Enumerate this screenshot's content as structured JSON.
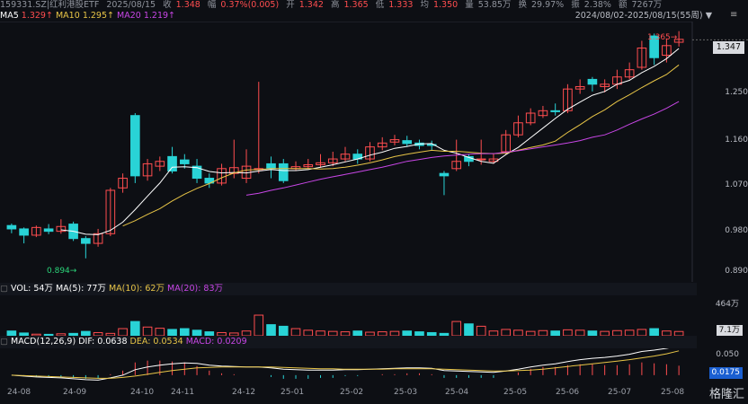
{
  "header": {
    "symbol": "159331.SZ|红利港股ETF",
    "date": "2025/08/15",
    "close_label": "收",
    "close": "1.348",
    "change_label": "幅",
    "change": "0.37%(0.005)",
    "open_label": "开",
    "open": "1.342",
    "high_label": "高",
    "high": "1.365",
    "low_label": "低",
    "low": "1.333",
    "avg_label": "均",
    "avg": "1.350",
    "volume_label": "量",
    "volume": "53.85万",
    "turnover_label": "换",
    "turnover": "29.97%",
    "amplitude_label": "振",
    "amplitude": "2.38%",
    "amount_label": "额",
    "amount": "7267万",
    "range": "2024/08/02-2025/08/15(55周)"
  },
  "ma_legend": {
    "ma5_label": "MA5",
    "ma5": "1.329↑",
    "ma10_label": "MA10",
    "ma10": "1.295↑",
    "ma20_label": "MA20",
    "ma20": "1.219↑"
  },
  "price_axis": {
    "ticks": [
      "1.250",
      "1.160",
      "1.070",
      "0.980",
      "0.890"
    ],
    "current": "1.347"
  },
  "annotations": {
    "max": "1.365",
    "min": "0.894"
  },
  "volume_panel": {
    "label": "VOL: 54万 MA(5): 77万 MA(10): 62万 MA(20): 83万",
    "vol": "VOL: 54万",
    "ma5": "MA(5): 77万",
    "ma10": "MA(10): 62万",
    "ma20": "MA(20): 83万",
    "axis_top": "464万",
    "current": "7.1万"
  },
  "macd_panel": {
    "label": "MACD(12,26,9)",
    "dif": "DIF: 0.0638",
    "dea": "DEA: 0.0534",
    "macd": "MACD: 0.0209",
    "axis_top": "0.050",
    "current": "0.0175"
  },
  "x_axis": [
    "24-08",
    "24-09",
    "24-10",
    "24-11",
    "24-12",
    "25-01",
    "25-02",
    "25-03",
    "25-04",
    "25-05",
    "25-06",
    "25-07",
    "25-08"
  ],
  "logo": "格隆汇",
  "colors": {
    "up": "#ff4d4f",
    "down": "#29d3d6",
    "ma5": "#ffffff",
    "ma10": "#e8c547",
    "ma20": "#c846e6",
    "bg": "#0d0f14"
  },
  "chart_data": {
    "type": "candlestick",
    "period": "weekly",
    "ylim": [
      0.86,
      1.37
    ],
    "candles": [
      {
        "o": 0.962,
        "c": 0.955,
        "h": 0.966,
        "l": 0.946
      },
      {
        "o": 0.955,
        "c": 0.942,
        "h": 0.958,
        "l": 0.925
      },
      {
        "o": 0.942,
        "c": 0.958,
        "h": 0.962,
        "l": 0.938
      },
      {
        "o": 0.955,
        "c": 0.95,
        "h": 0.965,
        "l": 0.944
      },
      {
        "o": 0.95,
        "c": 0.96,
        "h": 0.975,
        "l": 0.945
      },
      {
        "o": 0.965,
        "c": 0.935,
        "h": 0.97,
        "l": 0.93
      },
      {
        "o": 0.935,
        "c": 0.925,
        "h": 0.94,
        "l": 0.894
      },
      {
        "o": 0.925,
        "c": 0.945,
        "h": 0.955,
        "l": 0.918
      },
      {
        "o": 0.945,
        "c": 1.035,
        "h": 1.04,
        "l": 0.94
      },
      {
        "o": 1.04,
        "c": 1.06,
        "h": 1.07,
        "l": 1.03
      },
      {
        "o": 1.19,
        "c": 1.065,
        "h": 1.195,
        "l": 1.05
      },
      {
        "o": 1.065,
        "c": 1.09,
        "h": 1.1,
        "l": 1.055
      },
      {
        "o": 1.085,
        "c": 1.095,
        "h": 1.105,
        "l": 1.075
      },
      {
        "o": 1.105,
        "c": 1.075,
        "h": 1.125,
        "l": 1.07
      },
      {
        "o": 1.098,
        "c": 1.09,
        "h": 1.11,
        "l": 1.08
      },
      {
        "o": 1.085,
        "c": 1.06,
        "h": 1.1,
        "l": 1.05
      },
      {
        "o": 1.06,
        "c": 1.05,
        "h": 1.07,
        "l": 1.04
      },
      {
        "o": 1.05,
        "c": 1.08,
        "h": 1.09,
        "l": 1.045
      },
      {
        "o": 1.07,
        "c": 1.082,
        "h": 1.14,
        "l": 1.06
      },
      {
        "o": 1.06,
        "c": 1.085,
        "h": 1.12,
        "l": 1.05
      },
      {
        "o": 1.08,
        "c": 1.08,
        "h": 1.26,
        "l": 1.07
      },
      {
        "o": 1.09,
        "c": 1.08,
        "h": 1.105,
        "l": 1.06
      },
      {
        "o": 1.09,
        "c": 1.055,
        "h": 1.1,
        "l": 1.05
      },
      {
        "o": 1.08,
        "c": 1.084,
        "h": 1.095,
        "l": 1.075
      },
      {
        "o": 1.084,
        "c": 1.088,
        "h": 1.1,
        "l": 1.08
      },
      {
        "o": 1.088,
        "c": 1.092,
        "h": 1.11,
        "l": 1.082
      },
      {
        "o": 1.092,
        "c": 1.1,
        "h": 1.115,
        "l": 1.085
      },
      {
        "o": 1.1,
        "c": 1.11,
        "h": 1.125,
        "l": 1.095
      },
      {
        "o": 1.11,
        "c": 1.1,
        "h": 1.12,
        "l": 1.09
      },
      {
        "o": 1.1,
        "c": 1.125,
        "h": 1.135,
        "l": 1.095
      },
      {
        "o": 1.125,
        "c": 1.133,
        "h": 1.145,
        "l": 1.118
      },
      {
        "o": 1.135,
        "c": 1.14,
        "h": 1.15,
        "l": 1.128
      },
      {
        "o": 1.138,
        "c": 1.132,
        "h": 1.148,
        "l": 1.125
      },
      {
        "o": 1.133,
        "c": 1.128,
        "h": 1.14,
        "l": 1.12
      },
      {
        "o": 1.13,
        "c": 1.128,
        "h": 1.138,
        "l": 1.118
      },
      {
        "o": 1.07,
        "c": 1.065,
        "h": 1.075,
        "l": 1.025
      },
      {
        "o": 1.08,
        "c": 1.095,
        "h": 1.14,
        "l": 1.075
      },
      {
        "o": 1.105,
        "c": 1.095,
        "h": 1.11,
        "l": 1.085
      },
      {
        "o": 1.1,
        "c": 1.1,
        "h": 1.14,
        "l": 1.088
      },
      {
        "o": 1.095,
        "c": 1.1,
        "h": 1.11,
        "l": 1.09
      },
      {
        "o": 1.115,
        "c": 1.15,
        "h": 1.16,
        "l": 1.11
      },
      {
        "o": 1.15,
        "c": 1.175,
        "h": 1.19,
        "l": 1.145
      },
      {
        "o": 1.175,
        "c": 1.195,
        "h": 1.205,
        "l": 1.17
      },
      {
        "o": 1.19,
        "c": 1.2,
        "h": 1.21,
        "l": 1.185
      },
      {
        "o": 1.2,
        "c": 1.198,
        "h": 1.215,
        "l": 1.19
      },
      {
        "o": 1.2,
        "c": 1.245,
        "h": 1.255,
        "l": 1.195
      },
      {
        "o": 1.245,
        "c": 1.25,
        "h": 1.265,
        "l": 1.235
      },
      {
        "o": 1.265,
        "c": 1.255,
        "h": 1.27,
        "l": 1.24
      },
      {
        "o": 1.25,
        "c": 1.255,
        "h": 1.265,
        "l": 1.238
      },
      {
        "o": 1.255,
        "c": 1.27,
        "h": 1.285,
        "l": 1.245
      },
      {
        "o": 1.27,
        "c": 1.285,
        "h": 1.3,
        "l": 1.265
      },
      {
        "o": 1.29,
        "c": 1.33,
        "h": 1.345,
        "l": 1.285
      },
      {
        "o": 1.355,
        "c": 1.31,
        "h": 1.36,
        "l": 1.295
      },
      {
        "o": 1.315,
        "c": 1.335,
        "h": 1.35,
        "l": 1.3
      },
      {
        "o": 1.342,
        "c": 1.348,
        "h": 1.365,
        "l": 1.333
      }
    ],
    "ma5": [
      null,
      null,
      null,
      null,
      0.953,
      0.95,
      0.944,
      0.943,
      0.952,
      0.969,
      0.995,
      1.023,
      1.05,
      1.083,
      1.084,
      1.082,
      1.074,
      1.071,
      1.072,
      1.071,
      1.075,
      1.078,
      1.076,
      1.076,
      1.078,
      1.083,
      1.088,
      1.094,
      1.1,
      1.108,
      1.114,
      1.122,
      1.126,
      1.131,
      1.132,
      1.118,
      1.112,
      1.103,
      1.095,
      1.091,
      1.109,
      1.124,
      1.144,
      1.164,
      1.184,
      1.203,
      1.218,
      1.232,
      1.24,
      1.255,
      1.263,
      1.279,
      1.292,
      1.308,
      1.329
    ],
    "ma10": [
      null,
      null,
      null,
      null,
      null,
      null,
      null,
      null,
      null,
      0.961,
      0.972,
      0.985,
      0.997,
      1.013,
      1.027,
      1.039,
      1.049,
      1.061,
      1.071,
      1.077,
      1.078,
      1.08,
      1.08,
      1.08,
      1.08,
      1.079,
      1.08,
      1.083,
      1.087,
      1.092,
      1.098,
      1.105,
      1.11,
      1.114,
      1.118,
      1.116,
      1.116,
      1.114,
      1.112,
      1.111,
      1.112,
      1.118,
      1.124,
      1.129,
      1.137,
      1.155,
      1.171,
      1.188,
      1.202,
      1.219,
      1.233,
      1.248,
      1.262,
      1.275,
      1.295
    ],
    "ma20": [
      null,
      null,
      null,
      null,
      null,
      null,
      null,
      null,
      null,
      null,
      null,
      null,
      null,
      null,
      null,
      null,
      null,
      null,
      null,
      1.025,
      1.029,
      1.035,
      1.04,
      1.046,
      1.052,
      1.058,
      1.063,
      1.068,
      1.073,
      1.078,
      1.083,
      1.089,
      1.095,
      1.099,
      1.103,
      1.106,
      1.108,
      1.11,
      1.111,
      1.111,
      1.114,
      1.117,
      1.121,
      1.125,
      1.129,
      1.133,
      1.138,
      1.145,
      1.15,
      1.16,
      1.172,
      1.183,
      1.193,
      1.205,
      1.219
    ],
    "volume": [
      60,
      35,
      20,
      18,
      25,
      30,
      55,
      40,
      30,
      90,
      180,
      110,
      95,
      80,
      90,
      70,
      50,
      40,
      35,
      60,
      260,
      140,
      120,
      90,
      70,
      60,
      55,
      50,
      60,
      45,
      50,
      55,
      60,
      50,
      40,
      30,
      180,
      150,
      120,
      60,
      80,
      70,
      55,
      65,
      60,
      75,
      70,
      60,
      55,
      65,
      70,
      80,
      90,
      60,
      54
    ],
    "volume_ylim": [
      0,
      464
    ],
    "dif": [
      0,
      -0.002,
      -0.004,
      -0.005,
      -0.006,
      -0.008,
      -0.01,
      -0.011,
      -0.006,
      0.0,
      0.012,
      0.018,
      0.022,
      0.025,
      0.027,
      0.026,
      0.022,
      0.02,
      0.019,
      0.018,
      0.018,
      0.016,
      0.013,
      0.012,
      0.011,
      0.011,
      0.011,
      0.012,
      0.012,
      0.013,
      0.014,
      0.015,
      0.016,
      0.016,
      0.015,
      0.01,
      0.009,
      0.008,
      0.007,
      0.006,
      0.009,
      0.013,
      0.018,
      0.022,
      0.025,
      0.03,
      0.034,
      0.037,
      0.039,
      0.042,
      0.046,
      0.052,
      0.055,
      0.059,
      0.0638
    ],
    "dea": [
      0,
      -0.001,
      -0.002,
      -0.003,
      -0.004,
      -0.005,
      -0.006,
      -0.007,
      -0.007,
      -0.005,
      -0.002,
      0.002,
      0.006,
      0.01,
      0.013,
      0.016,
      0.017,
      0.018,
      0.018,
      0.018,
      0.018,
      0.018,
      0.017,
      0.016,
      0.015,
      0.014,
      0.014,
      0.013,
      0.013,
      0.013,
      0.013,
      0.014,
      0.014,
      0.014,
      0.014,
      0.013,
      0.012,
      0.011,
      0.01,
      0.009,
      0.009,
      0.01,
      0.011,
      0.013,
      0.016,
      0.019,
      0.022,
      0.025,
      0.028,
      0.031,
      0.034,
      0.038,
      0.042,
      0.047,
      0.0534
    ],
    "macd_ylim": [
      -0.02,
      0.055
    ]
  }
}
